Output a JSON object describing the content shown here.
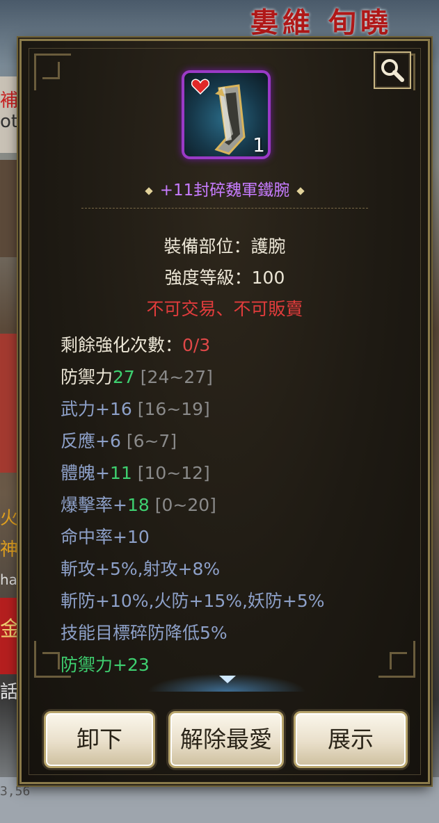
{
  "background": {
    "banner_text": "婁維  旬曉",
    "left_texts": [
      "補",
      "ot",
      "火",
      "神",
      "ha",
      "金",
      "話"
    ],
    "bottom_number": "3,56"
  },
  "dialog": {
    "search_icon": "magnifier-icon",
    "item": {
      "icon": "bracer-armor-icon",
      "favorite_icon": "heart-icon",
      "count": "1",
      "name": "+11封碎魏軍鐵腕",
      "name_color": "#c77cff"
    },
    "info": {
      "slot": "裝備部位：護腕",
      "level": "強度等級：100",
      "trade": "不可交易、不可販賣"
    },
    "stats": {
      "enhance_label": "剩餘強化次數：",
      "enhance_value": "0/3",
      "defense_label": "防禦力",
      "defense_value": "27",
      "defense_range": "[24~27]",
      "force": "武力+16",
      "force_range": "[16~19]",
      "reaction": "反應+6",
      "reaction_range": "[6~7]",
      "physique_label": "體魄+",
      "physique_value": "11",
      "physique_range": "[10~12]",
      "crit_label": "爆擊率+",
      "crit_value": "18",
      "crit_range": "[0~20]",
      "hit": "命中率+10",
      "attack": "斬攻+5%,射攻+8%",
      "resist": "斬防+10%,火防+15%,妖防+5%",
      "skill": "技能目標碎防降低5%",
      "bonus": "防禦力+23"
    },
    "buttons": {
      "unequip": "卸下",
      "unfavorite": "解除最愛",
      "show": "展示"
    }
  }
}
